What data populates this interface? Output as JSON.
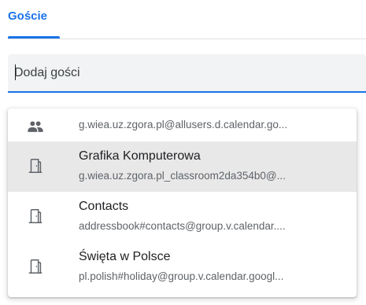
{
  "tab": {
    "label": "Goście"
  },
  "guest_input": {
    "placeholder": "Dodaj gości",
    "value": ""
  },
  "suggestions": [
    {
      "icon": "group-icon",
      "title": "",
      "subtitle": "g.wiea.uz.zgora.pl@allusers.d.calendar.go..."
    },
    {
      "icon": "room-door-icon",
      "title": "Grafika Komputerowa",
      "subtitle": "g.wiea.uz.zgora.pl_classroom2da354b0@..."
    },
    {
      "icon": "room-door-icon",
      "title": "Contacts",
      "subtitle": "addressbook#contacts@group.v.calendar...."
    },
    {
      "icon": "room-door-icon",
      "title": "Święta w Polsce",
      "subtitle": "pl.polish#holiday@group.v.calendar.googl..."
    }
  ],
  "colors": {
    "accent": "#1a73e8",
    "highlight": "#e8e8e8",
    "icon": "#5f6368"
  }
}
